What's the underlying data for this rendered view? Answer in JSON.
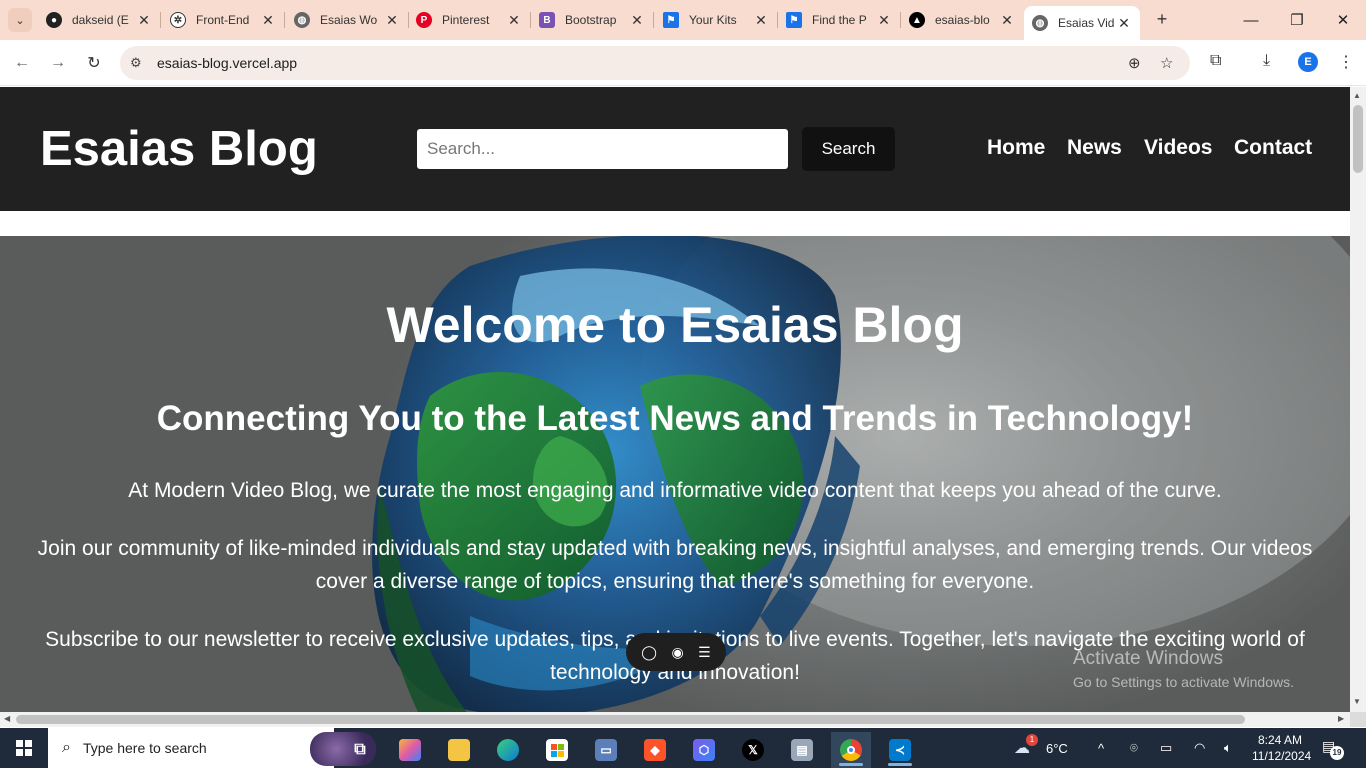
{
  "browser": {
    "tabs": [
      {
        "title": "dakseid (E",
        "icon": "github-icon"
      },
      {
        "title": "Front-End",
        "icon": "openai-icon"
      },
      {
        "title": "Esaias Wo",
        "icon": "globe-icon"
      },
      {
        "title": "Pinterest",
        "icon": "pinterest-icon"
      },
      {
        "title": "Bootstrap",
        "icon": "bootstrap-icon",
        "badge": "B"
      },
      {
        "title": "Your Kits",
        "icon": "flag-icon"
      },
      {
        "title": "Find the P",
        "icon": "flag-icon"
      },
      {
        "title": "esaias-blo",
        "icon": "vercel-icon"
      },
      {
        "title": "Esaias Vid",
        "icon": "globe-icon",
        "active": true
      }
    ],
    "url": "esaias-blog.vercel.app",
    "profile_initial": "E"
  },
  "site": {
    "brand": "Esaias Blog",
    "search_placeholder": "Search...",
    "search_button": "Search",
    "nav": [
      "Home",
      "News",
      "Videos",
      "Contact"
    ]
  },
  "hero": {
    "title": "Welcome to Esaias Blog",
    "subtitle": "Connecting You to the Latest News and Trends in Technology!",
    "p1": "At Modern Video Blog, we curate the most engaging and informative video content that keeps you ahead of the curve.",
    "p2": "Join our community of like-minded individuals and stay updated with breaking news, insightful analyses, and emerging trends. Our videos cover a diverse range of topics, ensuring that there's something for everyone.",
    "p3": "Subscribe to our newsletter to receive exclusive updates, tips, and invitations to live events. Together, let's navigate the exciting world of technology and innovation!"
  },
  "watermark": {
    "line1": "Activate Windows",
    "line2": "Go to Settings to activate Windows."
  },
  "taskbar": {
    "search_text": "Type here to search",
    "weather_temp": "6°C",
    "weather_alert": "1",
    "time": "8:24 AM",
    "date": "11/12/2024",
    "notification_count": "19"
  }
}
